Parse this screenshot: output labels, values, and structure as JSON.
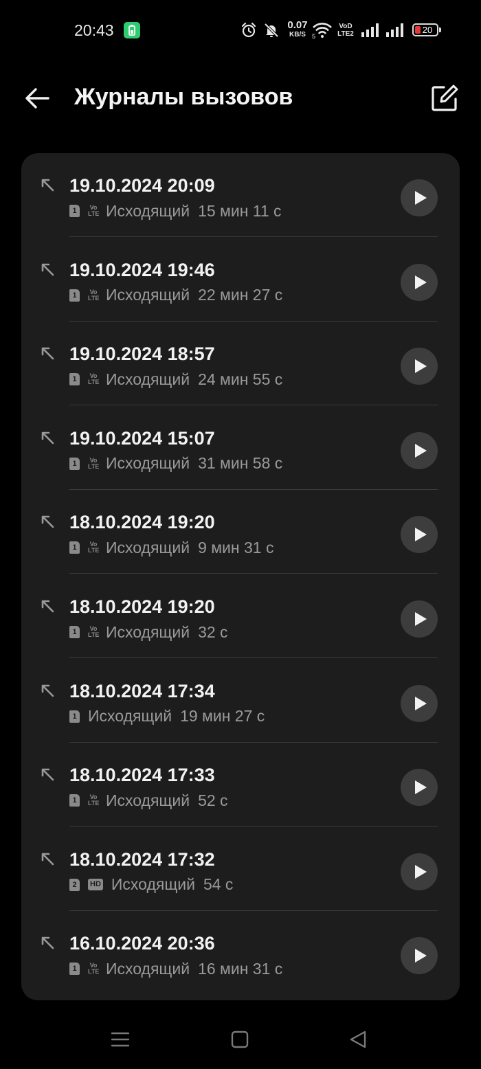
{
  "status_bar": {
    "time": "20:43",
    "net_speed_value": "0.07",
    "net_speed_unit": "KB/S",
    "wifi_badge": "5",
    "volte_line1": "VoD",
    "volte_line2": "LTE2",
    "battery_level": "20",
    "battery_color": "#e53935",
    "icons": [
      "battery-saver-icon",
      "alarm-icon",
      "mute-icon",
      "wifi-icon",
      "signal-sim1-icon",
      "signal-sim2-icon",
      "battery-icon"
    ]
  },
  "header": {
    "title": "Журналы вызовов",
    "back_icon": "arrow-left-icon",
    "edit_icon": "edit-icon"
  },
  "calls": [
    {
      "datetime": "19.10.2024 20:09",
      "sim": "1",
      "network": "volte",
      "network_label": "Vo\nLTE",
      "type": "Исходящий",
      "duration": "15 мин 11 с"
    },
    {
      "datetime": "19.10.2024 19:46",
      "sim": "1",
      "network": "volte",
      "network_label": "Vo\nLTE",
      "type": "Исходящий",
      "duration": "22 мин 27 с"
    },
    {
      "datetime": "19.10.2024 18:57",
      "sim": "1",
      "network": "volte",
      "network_label": "Vo\nLTE",
      "type": "Исходящий",
      "duration": "24 мин 55 с"
    },
    {
      "datetime": "19.10.2024 15:07",
      "sim": "1",
      "network": "volte",
      "network_label": "Vo\nLTE",
      "type": "Исходящий",
      "duration": "31 мин 58 с"
    },
    {
      "datetime": "18.10.2024 19:20",
      "sim": "1",
      "network": "volte",
      "network_label": "Vo\nLTE",
      "type": "Исходящий",
      "duration": "9 мин 31 с"
    },
    {
      "datetime": "18.10.2024 19:20",
      "sim": "1",
      "network": "volte",
      "network_label": "Vo\nLTE",
      "type": "Исходящий",
      "duration": "32 с"
    },
    {
      "datetime": "18.10.2024 17:34",
      "sim": "1",
      "network": "none",
      "network_label": "",
      "type": "Исходящий",
      "duration": "19 мин 27 с"
    },
    {
      "datetime": "18.10.2024 17:33",
      "sim": "1",
      "network": "volte",
      "network_label": "Vo\nLTE",
      "type": "Исходящий",
      "duration": "52 с"
    },
    {
      "datetime": "18.10.2024 17:32",
      "sim": "2",
      "network": "hd",
      "network_label": "HD",
      "type": "Исходящий",
      "duration": "54 с"
    },
    {
      "datetime": "16.10.2024 20:36",
      "sim": "1",
      "network": "volte",
      "network_label": "Vo\nLTE",
      "type": "Исходящий",
      "duration": "16 мин 31 с"
    }
  ],
  "nav_bar": {
    "icons": [
      "recent-apps-icon",
      "home-icon",
      "back-icon"
    ]
  },
  "colors": {
    "background": "#000000",
    "card": "#1d1d1d",
    "play_button": "#3d3d3d",
    "secondary_text": "#9a9a9a"
  }
}
